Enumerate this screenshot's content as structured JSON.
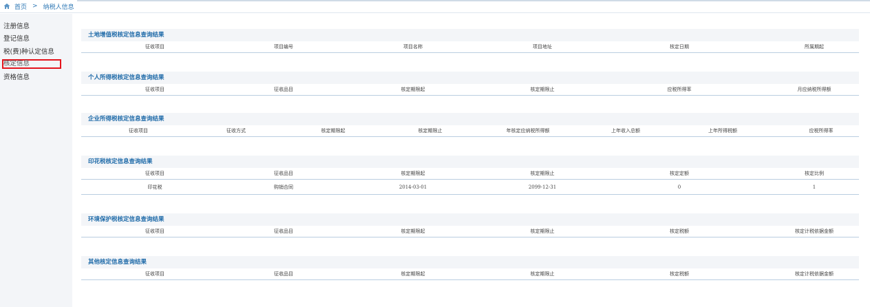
{
  "breadcrumb": {
    "home": "首页",
    "separator": ">",
    "current": "纳税人信息",
    "home_icon": "home-icon"
  },
  "sidebar": {
    "items": [
      {
        "label": "注册信息"
      },
      {
        "label": "登记信息"
      },
      {
        "label": "税(费)种认定信息"
      },
      {
        "label": "核定信息",
        "active": true
      },
      {
        "label": "资格信息"
      }
    ]
  },
  "sections": [
    {
      "title": "土地增值税核定信息查询结果",
      "columns": [
        "征收项目",
        "项目编号",
        "项目名称",
        "项目地址",
        "核定日期",
        "所属期起"
      ],
      "rows": []
    },
    {
      "title": "个人所得税核定信息查询结果",
      "columns": [
        "征收项目",
        "征收品目",
        "核定期限起",
        "核定期限止",
        "应税所得率",
        "月应纳税所得额"
      ],
      "rows": []
    },
    {
      "title": "企业所得税核定信息查询结果",
      "columns": [
        "征收项目",
        "征收方式",
        "核定期限起",
        "核定期限止",
        "年核定应纳税所得额",
        "上年收入总额",
        "上年所得税额",
        "应税所得率"
      ],
      "rows": []
    },
    {
      "title": "印花税核定信息查询结果",
      "columns": [
        "征收项目",
        "征收品目",
        "核定期限起",
        "核定期限止",
        "核定定额",
        "核定比例"
      ],
      "rows": [
        [
          "印花税",
          "购销合同",
          "2014-03-01",
          "2099-12-31",
          "0",
          "1"
        ]
      ]
    },
    {
      "title": "环境保护税核定信息查询结果",
      "columns": [
        "征收项目",
        "征收品目",
        "核定期限起",
        "核定期限止",
        "核定税额",
        "核定计税依据金额"
      ],
      "rows": []
    },
    {
      "title": "其他核定信息查询结果",
      "columns": [
        "征收项目",
        "征收品目",
        "核定期限起",
        "核定期限止",
        "核定税额",
        "核定计税依据金额"
      ],
      "rows": []
    }
  ],
  "colors": {
    "accent": "#1e6aa8",
    "highlight_border": "#e4141c",
    "sidebar_bg": "#f3f5f8"
  }
}
